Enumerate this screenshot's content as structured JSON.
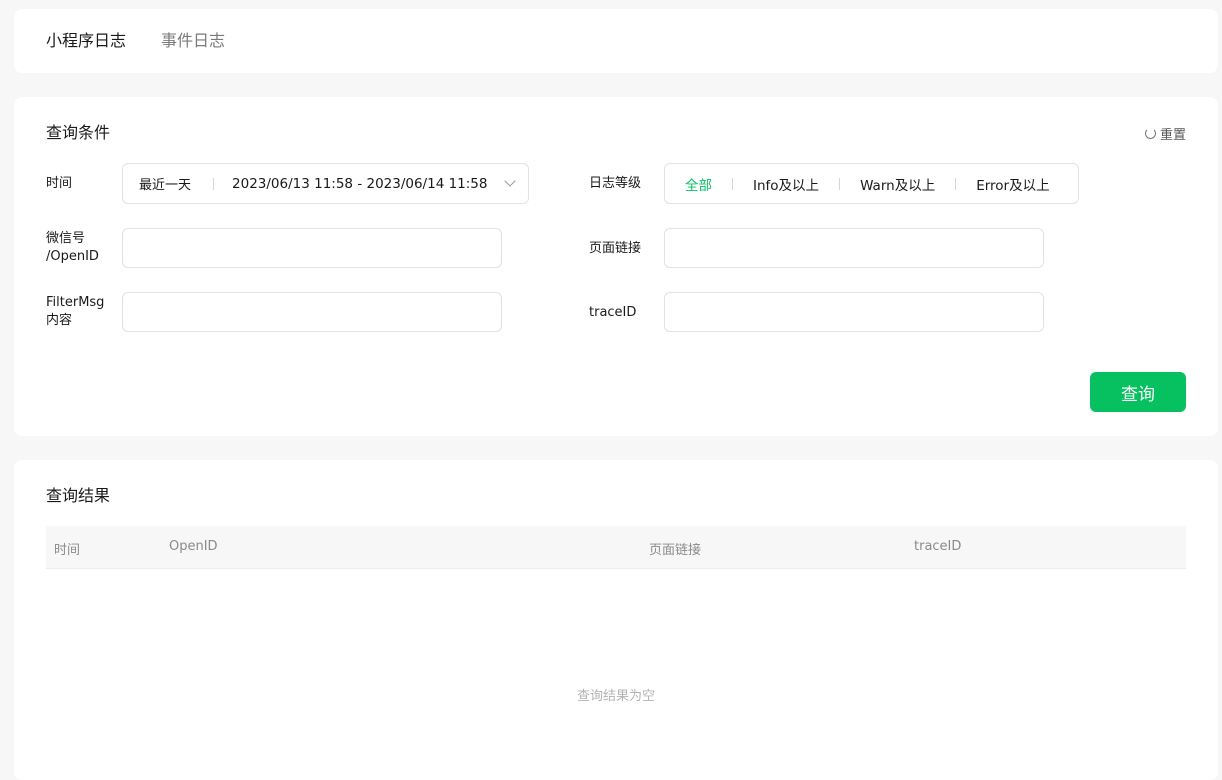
{
  "tabs": [
    {
      "label": "小程序日志",
      "active": true
    },
    {
      "label": "事件日志",
      "active": false
    }
  ],
  "query": {
    "title": "查询条件",
    "reset_label": "重置",
    "time_label": "时间",
    "time_preset": "最近一天",
    "time_range": "2023/06/13 11:58 - 2023/06/14 11:58",
    "level_label": "日志等级",
    "levels": [
      "全部",
      "Info及以上",
      "Warn及以上",
      "Error及以上"
    ],
    "level_selected": "全部",
    "openid_label_line1": "微信号",
    "openid_label_line2": "/OpenID",
    "page_link_label": "页面链接",
    "filtermsg_label_line1": "FilterMsg",
    "filtermsg_label_line2": "内容",
    "traceid_label": "traceID",
    "query_button": "查询"
  },
  "results": {
    "title": "查询结果",
    "columns": [
      "时间",
      "OpenID",
      "页面链接",
      "traceID"
    ],
    "empty_text": "查询结果为空"
  },
  "colors": {
    "accent": "#07c160",
    "background": "#f7f7f7"
  }
}
